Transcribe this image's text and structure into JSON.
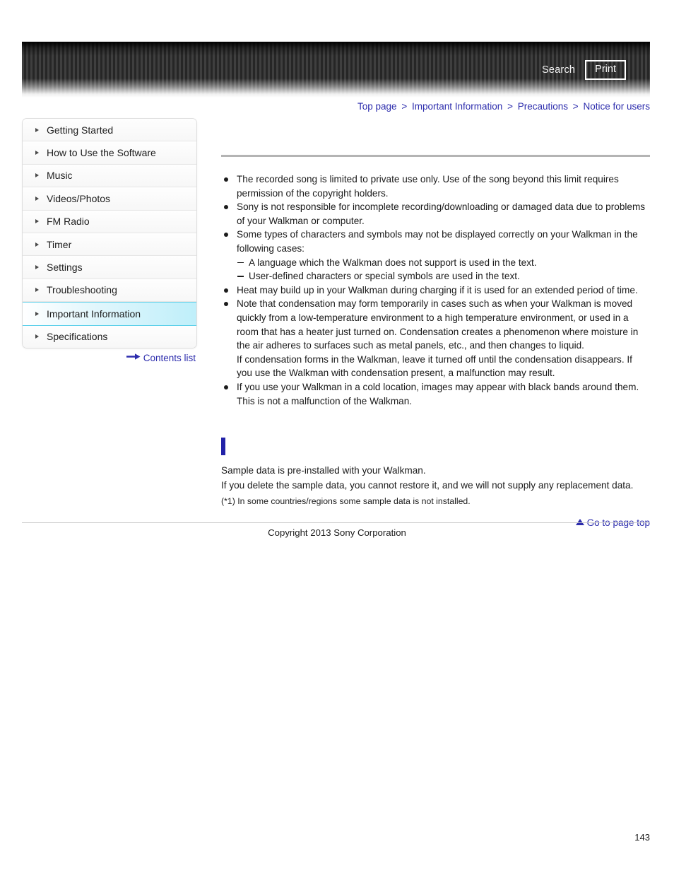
{
  "header": {
    "search_label": "Search",
    "print_label": "Print",
    "search_icon": "search-icon",
    "print_icon": "print-icon"
  },
  "breadcrumb": {
    "items": [
      {
        "label": "Top page"
      },
      {
        "label": "Important Information"
      },
      {
        "label": "Precautions"
      },
      {
        "label": "Notice for users"
      }
    ],
    "separator": ">"
  },
  "sidebar": {
    "items": [
      {
        "label": "Getting Started",
        "active": false
      },
      {
        "label": "How to Use the Software",
        "active": false
      },
      {
        "label": "Music",
        "active": false
      },
      {
        "label": "Videos/Photos",
        "active": false
      },
      {
        "label": "FM Radio",
        "active": false
      },
      {
        "label": "Timer",
        "active": false
      },
      {
        "label": "Settings",
        "active": false
      },
      {
        "label": "Troubleshooting",
        "active": false
      },
      {
        "label": "Important Information",
        "active": true
      },
      {
        "label": "Specifications",
        "active": false
      }
    ],
    "contents_list_label": "Contents list",
    "contents_list_icon": "right-arrow-icon"
  },
  "main": {
    "page_title": "",
    "notes": [
      {
        "text": "The recorded song is limited to private use only. Use of the song beyond this limit requires permission of the copyright holders.",
        "sub": []
      },
      {
        "text": "Sony is not responsible for incomplete recording/downloading or damaged data due to problems of your Walkman or computer.",
        "sub": []
      },
      {
        "text": "Some types of characters and symbols may not be displayed correctly on your Walkman in the following cases:",
        "sub": [
          "A language which the Walkman does not support is used in the text.",
          "User-defined characters or special symbols are used in the text."
        ]
      },
      {
        "text": "Heat may build up in your Walkman during charging if it is used for an extended period of time.",
        "sub": []
      },
      {
        "text": "Note that condensation may form temporarily in cases such as when your Walkman is moved quickly from a low-temperature environment to a high temperature environment, or used in a room that has a heater just turned on. Condensation creates a phenomenon where moisture in the air adheres to surfaces such as metal panels, etc., and then changes to liquid.\nIf condensation forms in the Walkman, leave it turned off until the condensation disappears. If you use the Walkman with condensation present, a malfunction may result.",
        "sub": []
      },
      {
        "text": "If you use your Walkman in a cold location, images may appear with black bands around them. This is not a malfunction of the Walkman.",
        "sub": []
      }
    ],
    "section": {
      "title": "",
      "marker_color": "#2222a8",
      "lines": [
        "Sample data is pre-installed with your Walkman.",
        "If you delete the sample data, you cannot restore it, and we will not supply any replacement data."
      ],
      "footnote": "(*1) In some countries/regions some sample data is not installed."
    },
    "goto_top_label": "Go to page top",
    "goto_top_icon": "up-triangle-icon"
  },
  "footer": {
    "copyright": "Copyright 2013 Sony Corporation",
    "page_number": "143"
  },
  "colors": {
    "link": "#2d2dad",
    "active_nav": "#bfeffa",
    "active_nav_border": "#5cd0ea",
    "rule": "#b4b4b4",
    "marker": "#2222a8"
  }
}
